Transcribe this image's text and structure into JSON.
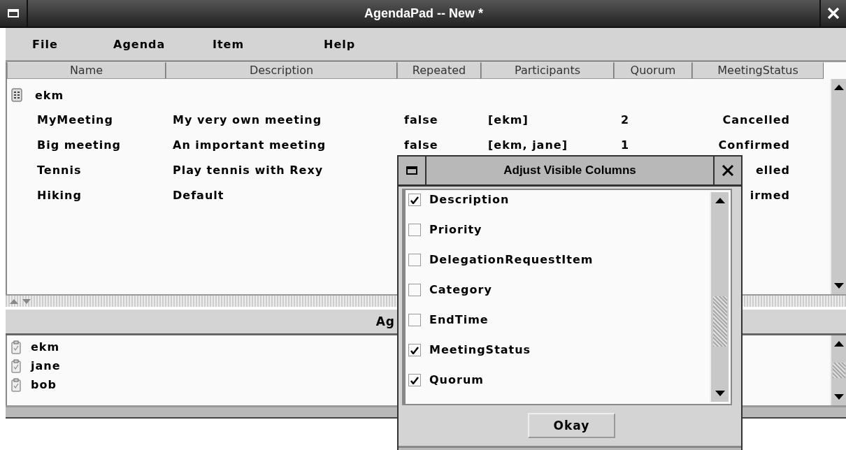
{
  "window": {
    "title": "AgendaPad -- New *"
  },
  "menu": [
    "File",
    "Agenda",
    "Item",
    "Help"
  ],
  "table": {
    "columns": [
      "Name",
      "Description",
      "Repeated",
      "Participants",
      "Quorum",
      "MeetingStatus"
    ],
    "groups": [
      {
        "name": "ekm",
        "children": [
          {
            "name": "MyMeeting",
            "description": "My very own meeting",
            "repeated": "false",
            "participants": "[ekm]",
            "quorum": "2",
            "status": "Cancelled"
          },
          {
            "name": "Big meeting",
            "description": "An important meeting",
            "repeated": "false",
            "participants": "[ekm, jane]",
            "quorum": "1",
            "status": "Confirmed"
          },
          {
            "name": "Tennis",
            "description": "Play tennis with Rexy",
            "status": "elled"
          },
          {
            "name": "Hiking",
            "description": "Default",
            "status": "irmed"
          }
        ]
      }
    ]
  },
  "agendas": {
    "title": "Ag",
    "items": [
      "ekm",
      "jane",
      "bob"
    ]
  },
  "dialog": {
    "title": "Adjust Visible Columns",
    "options": [
      {
        "label": "Description",
        "checked": true
      },
      {
        "label": "Priority",
        "checked": false
      },
      {
        "label": "DelegationRequestItem",
        "checked": false
      },
      {
        "label": "Category",
        "checked": false
      },
      {
        "label": "EndTime",
        "checked": false
      },
      {
        "label": "MeetingStatus",
        "checked": true
      },
      {
        "label": "Quorum",
        "checked": true
      }
    ],
    "button": "Okay"
  }
}
